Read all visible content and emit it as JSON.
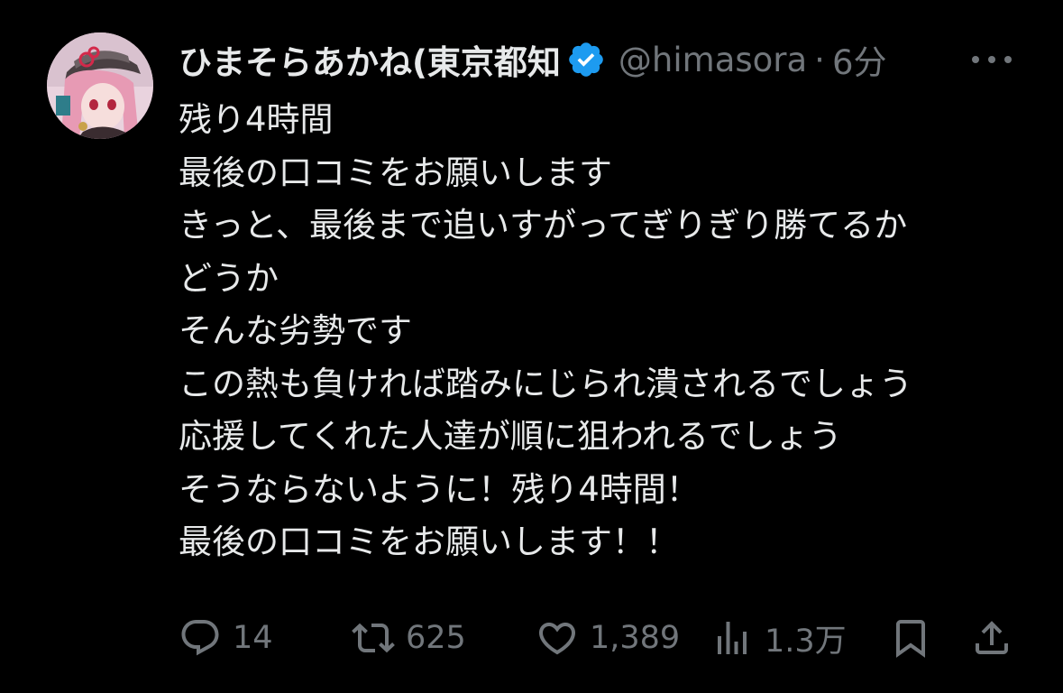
{
  "tweet": {
    "display_name": "ひまそらあかね(東京都知",
    "handle": "@himasora",
    "separator": "·",
    "time": "6分",
    "lines": [
      "残り4時間",
      "最後の口コミをお願いします",
      "きっと、最後まで追いすがってぎりぎり勝てるか",
      "どうか",
      "そんな劣勢です",
      "この熱も負ければ踏みにじられ潰されるでしょう",
      "応援してくれた人達が順に狙われるでしょう",
      "そうならないように！残り4時間！",
      "最後の口コミをお願いします！！"
    ]
  },
  "actions": {
    "reply_count": "14",
    "retweet_count": "625",
    "like_count": "1,389",
    "views_count": "1.3万"
  },
  "icons": {
    "verified": "verified-badge-icon",
    "more": "more-icon",
    "reply": "reply-icon",
    "retweet": "retweet-icon",
    "like": "heart-icon",
    "views": "views-icon",
    "bookmark": "bookmark-icon",
    "share": "share-icon"
  },
  "colors": {
    "background": "#000000",
    "text": "#e7e9ea",
    "muted": "#71767b",
    "verified": "#1d9bf0"
  }
}
